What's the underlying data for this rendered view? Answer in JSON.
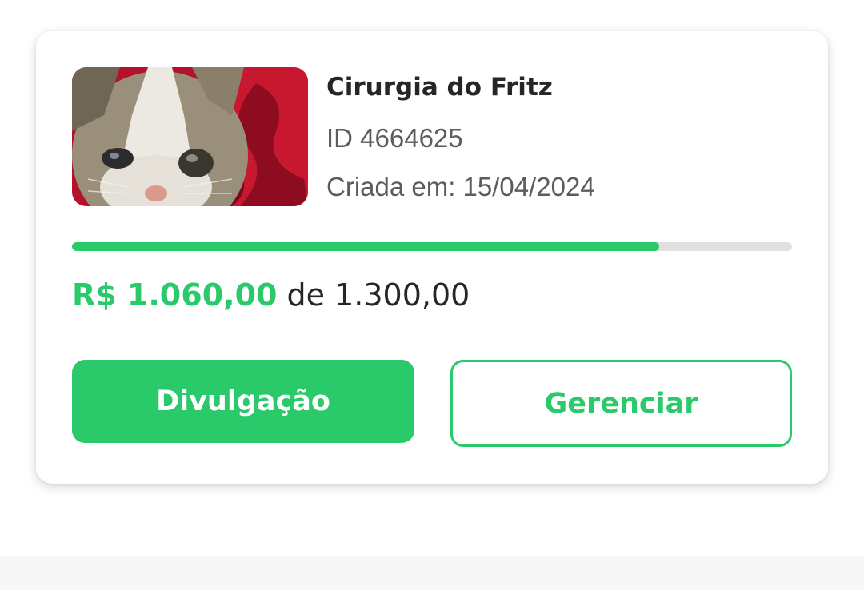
{
  "campaign": {
    "image_icon": "kitten-photo",
    "title": "Cirurgia do Fritz",
    "id_text": "ID 4664625",
    "created_text": "Criada em: 15/04/2024",
    "raised": "R$ 1.060,00",
    "goal_text": "de 1.300,00",
    "progress_fraction": 0.8154
  },
  "actions": {
    "share_label": "Divulgação",
    "manage_label": "Gerenciar"
  },
  "colors": {
    "accent": "#2ac96a",
    "track": "#e0e0e0",
    "text_dark": "#262626",
    "text_muted": "#5c5c5c"
  }
}
